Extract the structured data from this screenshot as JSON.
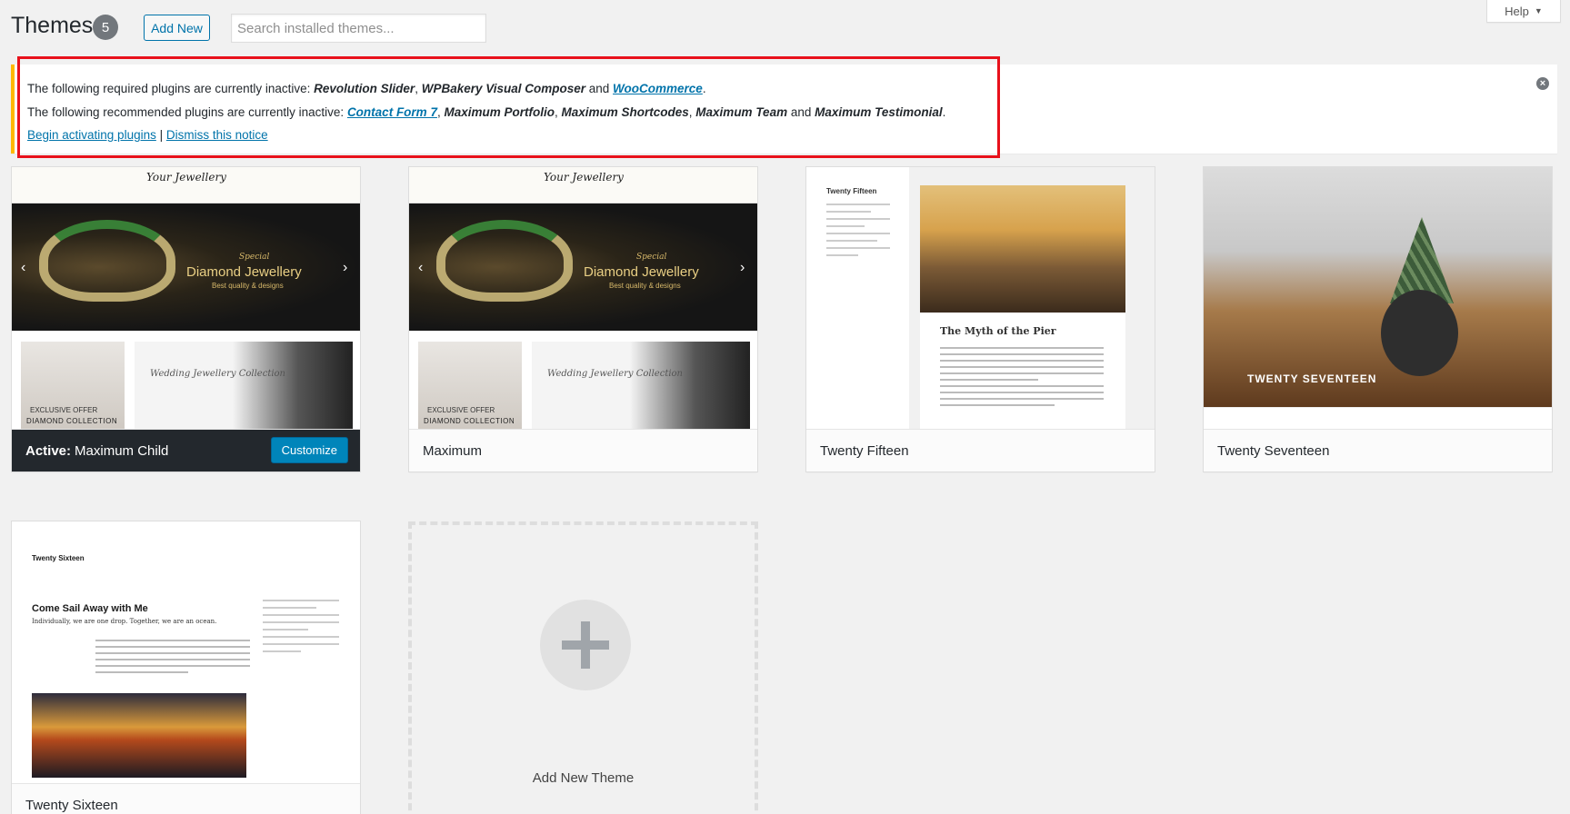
{
  "header": {
    "title": "Themes",
    "count": "5",
    "add_new_label": "Add New",
    "search_placeholder": "Search installed themes...",
    "help_label": "Help"
  },
  "notice": {
    "required_prefix": "The following required plugins are currently inactive: ",
    "required_p1": "Revolution Slider",
    "required_sep1": ", ",
    "required_p2": "WPBakery Visual Composer",
    "required_and": " and ",
    "required_p3": "WooCommerce",
    "required_end": ".",
    "recommended_prefix": "The following recommended plugins are currently inactive: ",
    "recommended_p1": "Contact Form 7",
    "recommended_sep": ", ",
    "recommended_p2": "Maximum Portfolio",
    "recommended_p3": "Maximum Shortcodes",
    "recommended_p4": "Maximum Team",
    "recommended_and": " and ",
    "recommended_p5": "Maximum Testimonial",
    "recommended_end": ".",
    "begin_label": "Begin activating plugins",
    "pipe": " | ",
    "dismiss_label": "Dismiss this notice",
    "highlight_color": "#e8111b"
  },
  "themes": [
    {
      "name": "Maximum Child",
      "active_label": "Active:",
      "customize_label": "Customize",
      "logo": "Your Jewellery",
      "hero_small": "Special",
      "hero_title": "Diamond Jewellery",
      "hero_sub": "Best quality & designs",
      "promo1_a": "EXCLUSIVE OFFER",
      "promo1_b": "DIAMOND COLLECTION",
      "promo2": "Wedding Jewellery Collection"
    },
    {
      "name": "Maximum",
      "logo": "Your Jewellery",
      "hero_small": "Special",
      "hero_title": "Diamond Jewellery",
      "hero_sub": "Best quality & designs",
      "promo1_a": "EXCLUSIVE OFFER",
      "promo1_b": "DIAMOND COLLECTION",
      "promo2": "Wedding Jewellery Collection"
    },
    {
      "name": "Twenty Fifteen",
      "site_title": "Twenty Fifteen",
      "post_title": "The Myth of the Pier"
    },
    {
      "name": "Twenty Seventeen",
      "site_title": "TWENTY SEVENTEEN"
    },
    {
      "name": "Twenty Sixteen",
      "site_title": "Twenty Sixteen",
      "post_title": "Come Sail Away with Me",
      "post_sub": "Individually, we are one drop. Together, we are an ocean."
    }
  ],
  "add_theme_label": "Add New Theme",
  "colors": {
    "accent": "#0073aa",
    "primary_button": "#0085ba",
    "notice_border": "#ffb900"
  }
}
